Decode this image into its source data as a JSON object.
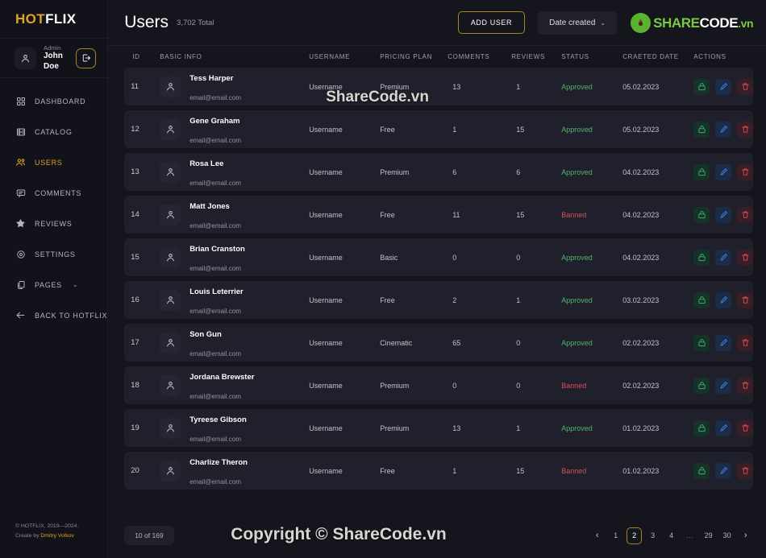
{
  "brand": {
    "part1": "HOT",
    "part2": "FLIX"
  },
  "account": {
    "role": "Admin",
    "name": "John Doe",
    "avatar_icon": "person-icon",
    "logout_icon": "logout-icon"
  },
  "sidebar": {
    "items": [
      {
        "label": "DASHBOARD",
        "icon": "grid-icon",
        "active": false
      },
      {
        "label": "CATALOG",
        "icon": "film-icon",
        "active": false
      },
      {
        "label": "USERS",
        "icon": "users-icon",
        "active": true
      },
      {
        "label": "COMMENTS",
        "icon": "chat-icon",
        "active": false
      },
      {
        "label": "REVIEWS",
        "icon": "star-icon",
        "active": false
      },
      {
        "label": "SETTINGS",
        "icon": "gear-icon",
        "active": false
      },
      {
        "label": "PAGES",
        "icon": "pages-icon",
        "active": false,
        "chevron": "⌄"
      },
      {
        "label": "BACK TO HOTFLIX",
        "icon": "arrow-left-icon",
        "active": false
      }
    ],
    "footer": {
      "copyright": "© HOTFLIX, 2019—2024.",
      "create_prefix": "Create by ",
      "author": "Dmitry Volkov"
    }
  },
  "header": {
    "title": "Users",
    "total": "3,702 Total",
    "add_user_label": "ADD USER",
    "sort_label": "Date created",
    "sort_chevron": "⌄",
    "logo": {
      "green": "SHARE",
      "white": "CODE",
      "suffix": ".vn",
      "mark_icon": "recycle-icon"
    }
  },
  "table": {
    "columns": [
      "ID",
      "BASIC INFO",
      "USERNAME",
      "PRICING PLAN",
      "COMMENTS",
      "REVIEWS",
      "STATUS",
      "CRAETED DATE",
      "ACTIONS"
    ],
    "action_icons": [
      "lock-icon",
      "edit-icon",
      "trash-icon"
    ],
    "rows": [
      {
        "id": "11",
        "name": "Tess Harper",
        "email": "email@email.com",
        "username": "Username",
        "plan": "Premium",
        "comments": "13",
        "reviews": "1",
        "status": "Approved",
        "date": "05.02.2023"
      },
      {
        "id": "12",
        "name": "Gene Graham",
        "email": "email@email.com",
        "username": "Username",
        "plan": "Free",
        "comments": "1",
        "reviews": "15",
        "status": "Approved",
        "date": "05.02.2023"
      },
      {
        "id": "13",
        "name": "Rosa Lee",
        "email": "email@email.com",
        "username": "Username",
        "plan": "Premium",
        "comments": "6",
        "reviews": "6",
        "status": "Approved",
        "date": "04.02.2023"
      },
      {
        "id": "14",
        "name": "Matt Jones",
        "email": "email@email.com",
        "username": "Username",
        "plan": "Free",
        "comments": "11",
        "reviews": "15",
        "status": "Banned",
        "date": "04.02.2023"
      },
      {
        "id": "15",
        "name": "Brian Cranston",
        "email": "email@email.com",
        "username": "Username",
        "plan": "Basic",
        "comments": "0",
        "reviews": "0",
        "status": "Approved",
        "date": "04.02.2023"
      },
      {
        "id": "16",
        "name": "Louis Leterrier",
        "email": "email@email.com",
        "username": "Username",
        "plan": "Free",
        "comments": "2",
        "reviews": "1",
        "status": "Approved",
        "date": "03.02.2023"
      },
      {
        "id": "17",
        "name": "Son Gun",
        "email": "email@email.com",
        "username": "Username",
        "plan": "Cinematic",
        "comments": "65",
        "reviews": "0",
        "status": "Approved",
        "date": "02.02.2023"
      },
      {
        "id": "18",
        "name": "Jordana Brewster",
        "email": "email@email.com",
        "username": "Username",
        "plan": "Premium",
        "comments": "0",
        "reviews": "0",
        "status": "Banned",
        "date": "02.02.2023"
      },
      {
        "id": "19",
        "name": "Tyreese Gibson",
        "email": "email@email.com",
        "username": "Username",
        "plan": "Premium",
        "comments": "13",
        "reviews": "1",
        "status": "Approved",
        "date": "01.02.2023"
      },
      {
        "id": "20",
        "name": "Charlize Theron",
        "email": "email@email.com",
        "username": "Username",
        "plan": "Free",
        "comments": "1",
        "reviews": "15",
        "status": "Banned",
        "date": "01.02.2023"
      }
    ]
  },
  "footer": {
    "count": "10 of 169",
    "pagination": [
      {
        "label": "‹",
        "type": "arrow"
      },
      {
        "label": "1",
        "type": "page"
      },
      {
        "label": "2",
        "type": "page",
        "active": true
      },
      {
        "label": "3",
        "type": "page"
      },
      {
        "label": "4",
        "type": "page"
      },
      {
        "label": "…",
        "type": "dots"
      },
      {
        "label": "29",
        "type": "page"
      },
      {
        "label": "30",
        "type": "page"
      },
      {
        "label": "›",
        "type": "arrow"
      }
    ]
  },
  "watermarks": {
    "row": "ShareCode.vn",
    "footer": "Copyright © ShareCode.vn"
  },
  "colors": {
    "accent": "#e0a326",
    "approved": "#53b36b",
    "banned": "#d4505a",
    "page_bg": "#15151d",
    "row_bg": "#20202c",
    "logo_green": "#7ac943"
  }
}
